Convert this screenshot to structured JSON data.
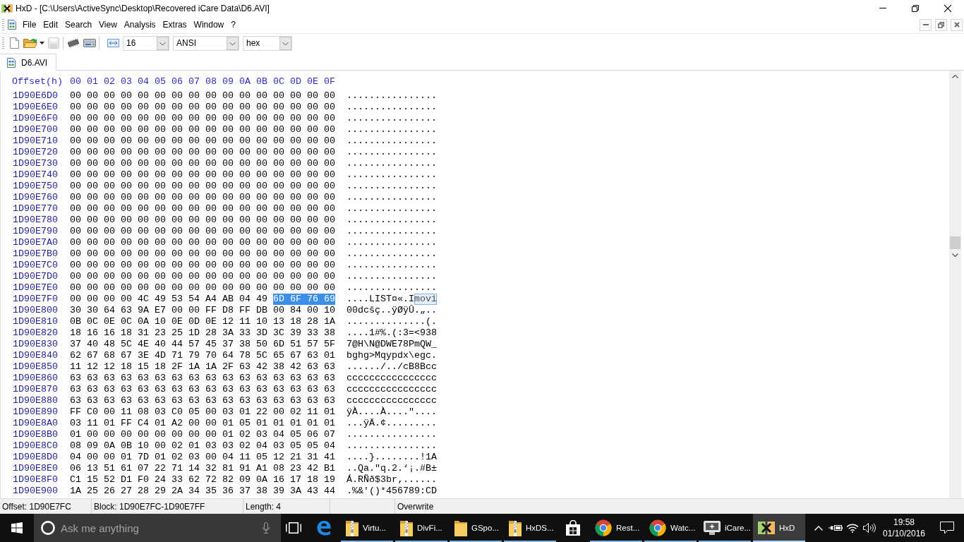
{
  "window": {
    "title": "HxD - [C:\\Users\\ActiveSync\\Desktop\\Recovered iCare Data\\D6.AVI]"
  },
  "menu": [
    "File",
    "Edit",
    "Search",
    "View",
    "Analysis",
    "Extras",
    "Window",
    "?"
  ],
  "toolbar": {
    "button_groups": [
      [
        {
          "kind": "new",
          "disabled": false
        },
        {
          "kind": "open",
          "disabled": false
        },
        {
          "kind": "save",
          "disabled": true
        }
      ],
      [
        {
          "kind": "chip",
          "disabled": false
        },
        {
          "kind": "drive",
          "disabled": false
        }
      ]
    ],
    "dropdowns": [
      "16",
      "ANSI",
      "hex"
    ]
  },
  "tabs": [
    {
      "label": "D6.AVI",
      "selected": true
    }
  ],
  "hex_view": {
    "header": {
      "offset": "Offset(h)",
      "columns": [
        "00",
        "01",
        "02",
        "03",
        "04",
        "05",
        "06",
        "07",
        "08",
        "09",
        "0A",
        "0B",
        "0C",
        "0D",
        "0E",
        "0F"
      ]
    },
    "rows": [
      {
        "offset": "1D90E6D0",
        "hex": [
          {
            "bytes": "00 00 00 00 00 00 00 00 00 00 00 00 00 00 00 00",
            "selected": false
          }
        ],
        "text": [
          {
            "chars": "................",
            "selected": false
          }
        ]
      },
      {
        "offset": "1D90E6E0",
        "hex": [
          {
            "bytes": "00 00 00 00 00 00 00 00 00 00 00 00 00 00 00 00",
            "selected": false
          }
        ],
        "text": [
          {
            "chars": "................",
            "selected": false
          }
        ]
      },
      {
        "offset": "1D90E6F0",
        "hex": [
          {
            "bytes": "00 00 00 00 00 00 00 00 00 00 00 00 00 00 00 00",
            "selected": false
          }
        ],
        "text": [
          {
            "chars": "................",
            "selected": false
          }
        ]
      },
      {
        "offset": "1D90E700",
        "hex": [
          {
            "bytes": "00 00 00 00 00 00 00 00 00 00 00 00 00 00 00 00",
            "selected": false
          }
        ],
        "text": [
          {
            "chars": "................",
            "selected": false
          }
        ]
      },
      {
        "offset": "1D90E710",
        "hex": [
          {
            "bytes": "00 00 00 00 00 00 00 00 00 00 00 00 00 00 00 00",
            "selected": false
          }
        ],
        "text": [
          {
            "chars": "................",
            "selected": false
          }
        ]
      },
      {
        "offset": "1D90E720",
        "hex": [
          {
            "bytes": "00 00 00 00 00 00 00 00 00 00 00 00 00 00 00 00",
            "selected": false
          }
        ],
        "text": [
          {
            "chars": "................",
            "selected": false
          }
        ]
      },
      {
        "offset": "1D90E730",
        "hex": [
          {
            "bytes": "00 00 00 00 00 00 00 00 00 00 00 00 00 00 00 00",
            "selected": false
          }
        ],
        "text": [
          {
            "chars": "................",
            "selected": false
          }
        ]
      },
      {
        "offset": "1D90E740",
        "hex": [
          {
            "bytes": "00 00 00 00 00 00 00 00 00 00 00 00 00 00 00 00",
            "selected": false
          }
        ],
        "text": [
          {
            "chars": "................",
            "selected": false
          }
        ]
      },
      {
        "offset": "1D90E750",
        "hex": [
          {
            "bytes": "00 00 00 00 00 00 00 00 00 00 00 00 00 00 00 00",
            "selected": false
          }
        ],
        "text": [
          {
            "chars": "................",
            "selected": false
          }
        ]
      },
      {
        "offset": "1D90E760",
        "hex": [
          {
            "bytes": "00 00 00 00 00 00 00 00 00 00 00 00 00 00 00 00",
            "selected": false
          }
        ],
        "text": [
          {
            "chars": "................",
            "selected": false
          }
        ]
      },
      {
        "offset": "1D90E770",
        "hex": [
          {
            "bytes": "00 00 00 00 00 00 00 00 00 00 00 00 00 00 00 00",
            "selected": false
          }
        ],
        "text": [
          {
            "chars": "................",
            "selected": false
          }
        ]
      },
      {
        "offset": "1D90E780",
        "hex": [
          {
            "bytes": "00 00 00 00 00 00 00 00 00 00 00 00 00 00 00 00",
            "selected": false
          }
        ],
        "text": [
          {
            "chars": "................",
            "selected": false
          }
        ]
      },
      {
        "offset": "1D90E790",
        "hex": [
          {
            "bytes": "00 00 00 00 00 00 00 00 00 00 00 00 00 00 00 00",
            "selected": false
          }
        ],
        "text": [
          {
            "chars": "................",
            "selected": false
          }
        ]
      },
      {
        "offset": "1D90E7A0",
        "hex": [
          {
            "bytes": "00 00 00 00 00 00 00 00 00 00 00 00 00 00 00 00",
            "selected": false
          }
        ],
        "text": [
          {
            "chars": "................",
            "selected": false
          }
        ]
      },
      {
        "offset": "1D90E7B0",
        "hex": [
          {
            "bytes": "00 00 00 00 00 00 00 00 00 00 00 00 00 00 00 00",
            "selected": false
          }
        ],
        "text": [
          {
            "chars": "................",
            "selected": false
          }
        ]
      },
      {
        "offset": "1D90E7C0",
        "hex": [
          {
            "bytes": "00 00 00 00 00 00 00 00 00 00 00 00 00 00 00 00",
            "selected": false
          }
        ],
        "text": [
          {
            "chars": "................",
            "selected": false
          }
        ]
      },
      {
        "offset": "1D90E7D0",
        "hex": [
          {
            "bytes": "00 00 00 00 00 00 00 00 00 00 00 00 00 00 00 00",
            "selected": false
          }
        ],
        "text": [
          {
            "chars": "................",
            "selected": false
          }
        ]
      },
      {
        "offset": "1D90E7E0",
        "hex": [
          {
            "bytes": "00 00 00 00 00 00 00 00 00 00 00 00 00 00 00 00",
            "selected": false
          }
        ],
        "text": [
          {
            "chars": "................",
            "selected": false
          }
        ]
      },
      {
        "offset": "1D90E7F0",
        "hex": [
          {
            "bytes": "00 00 00 00 4C 49 53 54 A4 AB 04 49",
            "selected": false
          },
          {
            "bytes": "6D 6F 76 69",
            "selected": true
          }
        ],
        "text": [
          {
            "chars": "....LIST¤«.I",
            "selected": false
          },
          {
            "chars": "movi",
            "selected": true
          }
        ]
      },
      {
        "offset": "1D90E800",
        "hex": [
          {
            "bytes": "30 30 64 63 9A E7 00 00 FF D8 FF DB 00 84 00 10",
            "selected": false
          }
        ],
        "text": [
          {
            "chars": "00dcšç..ÿØÿÛ.„..",
            "selected": false
          }
        ]
      },
      {
        "offset": "1D90E810",
        "hex": [
          {
            "bytes": "0B 0C 0E 0C 0A 10 0E 0D 0E 12 11 10 13 18 28 1A",
            "selected": false
          }
        ],
        "text": [
          {
            "chars": "..............(.",
            "selected": false
          }
        ]
      },
      {
        "offset": "1D90E820",
        "hex": [
          {
            "bytes": "18 16 16 18 31 23 25 1D 28 3A 33 3D 3C 39 33 38",
            "selected": false
          }
        ],
        "text": [
          {
            "chars": "....1#%.(:3=<938",
            "selected": false
          }
        ]
      },
      {
        "offset": "1D90E830",
        "hex": [
          {
            "bytes": "37 40 48 5C 4E 40 44 57 45 37 38 50 6D 51 57 5F",
            "selected": false
          }
        ],
        "text": [
          {
            "chars": "7@H\\N@DWE78PmQW_",
            "selected": false
          }
        ]
      },
      {
        "offset": "1D90E840",
        "hex": [
          {
            "bytes": "62 67 68 67 3E 4D 71 79 70 64 78 5C 65 67 63 01",
            "selected": false
          }
        ],
        "text": [
          {
            "chars": "bghg>Mqypdx\\egc.",
            "selected": false
          }
        ]
      },
      {
        "offset": "1D90E850",
        "hex": [
          {
            "bytes": "11 12 12 18 15 18 2F 1A 1A 2F 63 42 38 42 63 63",
            "selected": false
          }
        ],
        "text": [
          {
            "chars": "....../../cB8Bcc",
            "selected": false
          }
        ]
      },
      {
        "offset": "1D90E860",
        "hex": [
          {
            "bytes": "63 63 63 63 63 63 63 63 63 63 63 63 63 63 63 63",
            "selected": false
          }
        ],
        "text": [
          {
            "chars": "cccccccccccccccc",
            "selected": false
          }
        ]
      },
      {
        "offset": "1D90E870",
        "hex": [
          {
            "bytes": "63 63 63 63 63 63 63 63 63 63 63 63 63 63 63 63",
            "selected": false
          }
        ],
        "text": [
          {
            "chars": "cccccccccccccccc",
            "selected": false
          }
        ]
      },
      {
        "offset": "1D90E880",
        "hex": [
          {
            "bytes": "63 63 63 63 63 63 63 63 63 63 63 63 63 63 63 63",
            "selected": false
          }
        ],
        "text": [
          {
            "chars": "cccccccccccccccc",
            "selected": false
          }
        ]
      },
      {
        "offset": "1D90E890",
        "hex": [
          {
            "bytes": "FF C0 00 11 08 03 C0 05 00 03 01 22 00 02 11 01",
            "selected": false
          }
        ],
        "text": [
          {
            "chars": "ÿÀ....À....\"....",
            "selected": false
          }
        ]
      },
      {
        "offset": "1D90E8A0",
        "hex": [
          {
            "bytes": "03 11 01 FF C4 01 A2 00 00 01 05 01 01 01 01 01",
            "selected": false
          }
        ],
        "text": [
          {
            "chars": "...ÿÄ.¢.........",
            "selected": false
          }
        ]
      },
      {
        "offset": "1D90E8B0",
        "hex": [
          {
            "bytes": "01 00 00 00 00 00 00 00 00 01 02 03 04 05 06 07",
            "selected": false
          }
        ],
        "text": [
          {
            "chars": "................",
            "selected": false
          }
        ]
      },
      {
        "offset": "1D90E8C0",
        "hex": [
          {
            "bytes": "08 09 0A 0B 10 00 02 01 03 03 02 04 03 05 05 04",
            "selected": false
          }
        ],
        "text": [
          {
            "chars": "................",
            "selected": false
          }
        ]
      },
      {
        "offset": "1D90E8D0",
        "hex": [
          {
            "bytes": "04 00 00 01 7D 01 02 03 00 04 11 05 12 21 31 41",
            "selected": false
          }
        ],
        "text": [
          {
            "chars": "....}........!1A",
            "selected": false
          }
        ]
      },
      {
        "offset": "1D90E8E0",
        "hex": [
          {
            "bytes": "06 13 51 61 07 22 71 14 32 81 91 A1 08 23 42 B1",
            "selected": false
          }
        ],
        "text": [
          {
            "chars": "..Qa.\"q.2.‘¡.#B±",
            "selected": false
          }
        ]
      },
      {
        "offset": "1D90E8F0",
        "hex": [
          {
            "bytes": "C1 15 52 D1 F0 24 33 62 72 82 09 0A 16 17 18 19",
            "selected": false
          }
        ],
        "text": [
          {
            "chars": "Á.RÑð$3br‚......",
            "selected": false
          }
        ]
      },
      {
        "offset": "1D90E900",
        "hex": [
          {
            "bytes": "1A 25 26 27 28 29 2A 34 35 36 37 38 39 3A 43 44",
            "selected": false
          }
        ],
        "text": [
          {
            "chars": ".%&'()*456789:CD",
            "selected": false
          }
        ]
      }
    ]
  },
  "status_bar": [
    "Offset: 1D90E7FC",
    "Block: 1D90E7FC-1D90E7FF",
    "Length: 4",
    "Overwrite"
  ],
  "taskbar": {
    "search": {
      "placeholder": "Ask me anything"
    },
    "items": [
      {
        "kind": "edge",
        "running": false,
        "selected": false
      },
      {
        "kind": "zip_folder",
        "label": "Virtu...",
        "running": true,
        "selected": false
      },
      {
        "kind": "zip_folder",
        "label": "DivFi...",
        "running": true,
        "selected": false
      },
      {
        "kind": "folder",
        "label": "GSpo...",
        "running": true,
        "selected": false
      },
      {
        "kind": "zip_folder",
        "label": "HxDS...",
        "running": true,
        "selected": false
      },
      {
        "kind": "store",
        "running": false,
        "selected": false
      },
      {
        "kind": "chrome",
        "label": "Rest...",
        "running": true,
        "selected": false
      },
      {
        "kind": "chrome",
        "label": "Watc...",
        "running": true,
        "selected": false
      },
      {
        "kind": "monitor",
        "label": "iCare...",
        "running": true,
        "selected": false
      },
      {
        "kind": "hxd",
        "label": "HxD",
        "running": true,
        "selected": true
      }
    ],
    "clock": {
      "time": "19:58",
      "date": "01/10/2016"
    }
  }
}
